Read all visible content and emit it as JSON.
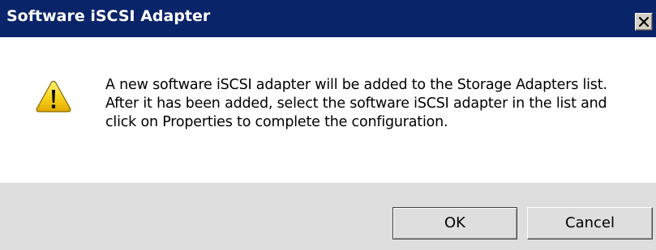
{
  "window": {
    "title": "Software iSCSI Adapter",
    "close_icon": "close-icon",
    "titlebar_color": "#0a246a"
  },
  "dialog": {
    "icon": "warning-icon",
    "message": "A new software iSCSI adapter will be added to the Storage Adapters list. After it has been added, select the software iSCSI adapter in the list and click on Properties to complete the configuration."
  },
  "buttons": {
    "ok_label": "OK",
    "cancel_label": "Cancel"
  },
  "colors": {
    "footer_background": "#dedede",
    "warning_yellow": "#f8d21c"
  }
}
